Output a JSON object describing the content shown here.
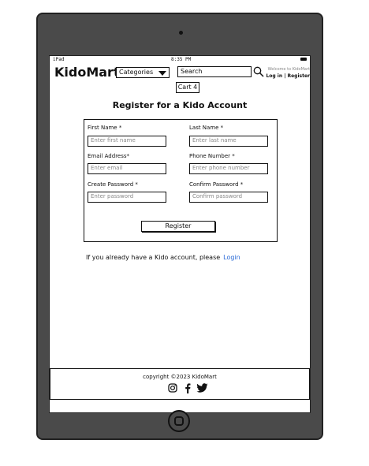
{
  "status_bar": {
    "device": "iPad",
    "time": "8:35 PM"
  },
  "header": {
    "logo": "KidoMart",
    "categories_label": "Categories",
    "search_placeholder": "Search",
    "welcome_text": "Welcome to KidoMart",
    "login_text": "Log in",
    "register_text": "Register",
    "cart_label": "Cart 4"
  },
  "form": {
    "title": "Register for a Kido Account",
    "first_name_label": "First Name *",
    "first_name_placeholder": "Enter first name",
    "last_name_label": "Last Name *",
    "last_name_placeholder": "Enter last name",
    "email_label": "Email Address*",
    "email_placeholder": "Enter email",
    "phone_label": "Phone Number *",
    "phone_placeholder": "Enter phone number",
    "password_label": "Create Password *",
    "password_placeholder": "Enter password",
    "confirm_label": "Confirm Password *",
    "confirm_placeholder": "Confirm password",
    "submit_label": "Register"
  },
  "already": {
    "text": "If you already have a Kido account, please",
    "link": "Login",
    "link_color": "#2a6ad6"
  },
  "footer": {
    "copyright": "copyright ©2023 KidoMart",
    "icons": [
      "instagram-icon",
      "facebook-icon",
      "twitter-icon"
    ]
  }
}
